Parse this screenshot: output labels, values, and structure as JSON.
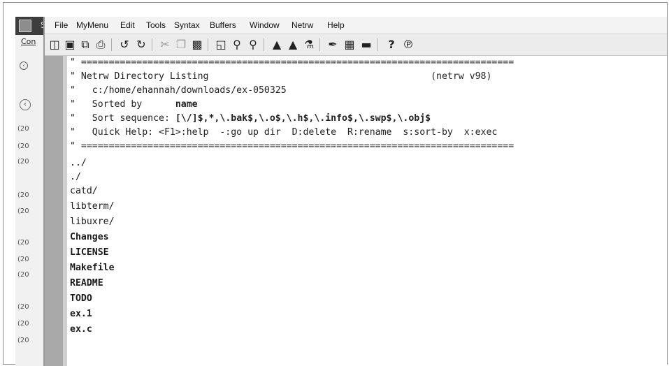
{
  "menu": [
    "File",
    "MyMenu",
    "Edit",
    "Tools",
    "Syntax",
    "Buffers",
    "Window",
    "Netrw",
    "Help"
  ],
  "background_window": {
    "label": "Con",
    "years": [
      "(20",
      "(20",
      "(20",
      "(20",
      "(20",
      "(20",
      "(20",
      "(20",
      "(20",
      "(20",
      "(20"
    ]
  },
  "toolbar_icons": [
    "open-icon",
    "save-icon",
    "save-all-icon",
    "print-icon",
    "undo-icon",
    "redo-icon",
    "cut-icon",
    "copy-icon",
    "paste-icon",
    "replace-icon",
    "find-next-icon",
    "find-prev-icon",
    "load-session-icon",
    "save-session-icon",
    "run-script-icon",
    "make-icon",
    "shell-icon",
    "tags-icon",
    "help-icon",
    "find-help-icon"
  ],
  "header": {
    "sep": "\" ==============================================================================",
    "title": "\" Netrw Directory Listing                                        (netrw v98)",
    "path": "\"   c:/home/ehannah/downloads/ex-050325",
    "sorted_prefix": "\"   Sorted by      ",
    "sorted_value": "name",
    "sort_prefix": "\"   Sort sequence: ",
    "sort_value": "[\\/]$,*,\\.bak$,\\.o$,\\.h$,\\.info$,\\.swp$,\\.obj$",
    "quick": "\"   Quick Help: <F1>:help  -:go up dir  D:delete  R:rename  s:sort-by  x:exec",
    "sep2": "\" =============================================================================="
  },
  "entries": [
    "../",
    "./",
    "catd/",
    "libterm/",
    "libuxre/",
    "Changes",
    "LICENSE",
    "Makefile",
    "README",
    "TODO",
    "ex.1",
    "ex.c"
  ]
}
